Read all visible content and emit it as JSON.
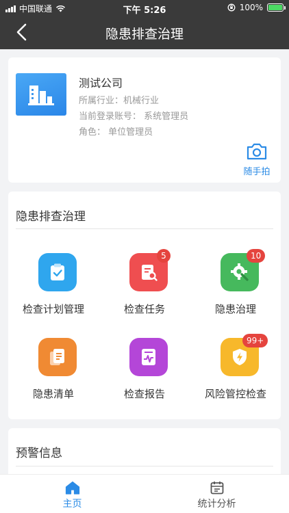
{
  "status_bar": {
    "carrier": "中国联通",
    "time": "下午 5:26",
    "battery_percent": "100%",
    "battery_level": 1.0
  },
  "nav": {
    "title": "隐患排查治理",
    "back_icon": "chevron-left-icon"
  },
  "company": {
    "name": "测试公司",
    "industry": "所属行业：机械行业",
    "account": "当前登录账号：  系统管理员",
    "role": "角色：  单位管理员",
    "snap_label": "随手拍",
    "snap_icon": "camera-icon"
  },
  "check_section": {
    "title": "隐患排查治理",
    "items": [
      {
        "label": "检查计划管理",
        "icon": "clipboard-check-icon",
        "color": "#2fa6ee",
        "badge": ""
      },
      {
        "label": "检查任务",
        "icon": "document-search-icon",
        "color": "#ef4e50",
        "badge": "5"
      },
      {
        "label": "隐患治理",
        "icon": "gear-wrench-icon",
        "color": "#46b95d",
        "badge": "10"
      },
      {
        "label": "隐患清单",
        "icon": "document-list-icon",
        "color": "#f08a33",
        "badge": ""
      },
      {
        "label": "检查报告",
        "icon": "report-chart-icon",
        "color": "#b446d8",
        "badge": ""
      },
      {
        "label": "风险管控检查",
        "icon": "shield-bolt-icon",
        "color": "#f7b82b",
        "badge": "99+"
      }
    ]
  },
  "warning_section": {
    "title": "预警信息"
  },
  "tabs": [
    {
      "label": "主页",
      "icon": "home-icon",
      "active": true
    },
    {
      "label": "统计分析",
      "icon": "calendar-chart-icon",
      "active": false
    }
  ],
  "colors": {
    "accent": "#2b8be6",
    "header": "#3a3a3a",
    "badge": "#e5443e"
  }
}
